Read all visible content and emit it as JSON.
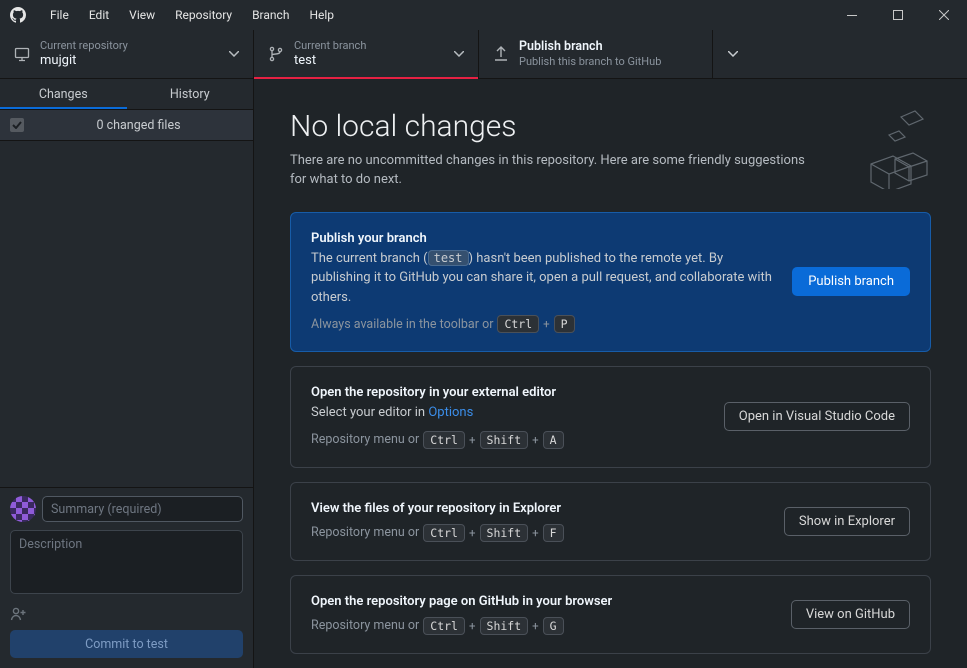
{
  "menu": {
    "items": [
      "File",
      "Edit",
      "View",
      "Repository",
      "Branch",
      "Help"
    ]
  },
  "toolbar": {
    "repo": {
      "label": "Current repository",
      "value": "mujgit"
    },
    "branch": {
      "label": "Current branch",
      "value": "test"
    },
    "publish": {
      "title": "Publish branch",
      "subtitle": "Publish this branch to GitHub"
    }
  },
  "sidebar": {
    "tabs": {
      "changes": "Changes",
      "history": "History"
    },
    "changed": "0 changed files",
    "summary_placeholder": "Summary (required)",
    "description_placeholder": "Description",
    "commit_button": "Commit to test"
  },
  "hero": {
    "title": "No local changes",
    "body": "There are no uncommitted changes in this repository. Here are some friendly suggestions for what to do next."
  },
  "cards": {
    "publish": {
      "title": "Publish your branch",
      "desc_pre": "The current branch (",
      "desc_chip": "test",
      "desc_post": ") hasn't been published to the remote yet. By publishing it to GitHub you can share it, open a pull request, and collaborate with others.",
      "hint_pre": "Always available in the toolbar or",
      "kbd1": "Ctrl",
      "kbd2": "P",
      "button": "Publish branch"
    },
    "editor": {
      "title": "Open the repository in your external editor",
      "desc_pre": "Select your editor in ",
      "link": "Options",
      "hint_pre": "Repository menu or",
      "kbd1": "Ctrl",
      "kbd2": "Shift",
      "kbd3": "A",
      "button": "Open in Visual Studio Code"
    },
    "explorer": {
      "title": "View the files of your repository in Explorer",
      "hint_pre": "Repository menu or",
      "kbd1": "Ctrl",
      "kbd2": "Shift",
      "kbd3": "F",
      "button": "Show in Explorer"
    },
    "github": {
      "title": "Open the repository page on GitHub in your browser",
      "hint_pre": "Repository menu or",
      "kbd1": "Ctrl",
      "kbd2": "Shift",
      "kbd3": "G",
      "button": "View on GitHub"
    }
  }
}
